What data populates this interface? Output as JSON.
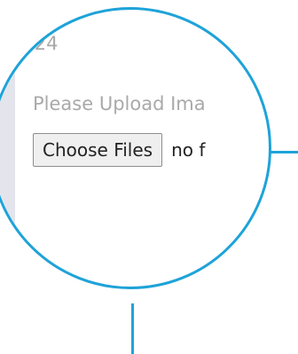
{
  "zoom": {
    "page_counter": "/ 24",
    "upload_label": "Please Upload Ima",
    "choose_files_label": "Choose Files",
    "file_status": "no f"
  },
  "colors": {
    "callout_accent": "#1ea3d8",
    "muted_text": "#a9a9a9",
    "side_strip": "#e3e4ec"
  }
}
